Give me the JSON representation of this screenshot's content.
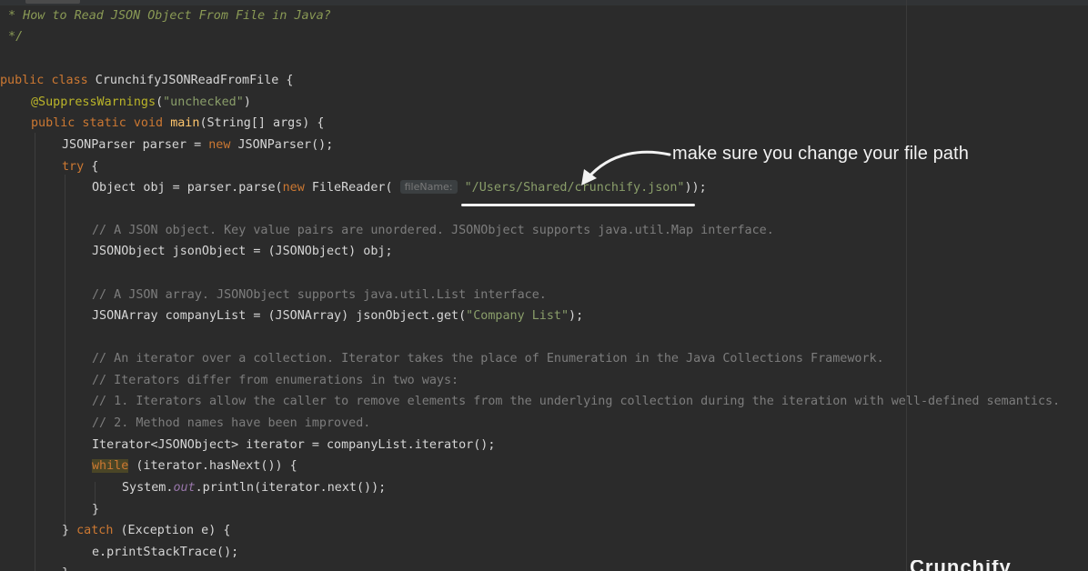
{
  "editor": {
    "language": "java",
    "theme_colors": {
      "background": "#2b2b2b",
      "keyword": "#cc7832",
      "string": "#8a9e6a",
      "comment": "#7d7d7d",
      "doc_comment": "#8a9a55",
      "annotation": "#bbb529",
      "method": "#ffc66d",
      "static_field": "#9876aa"
    },
    "code": {
      "doc_line": " * How to Read JSON Object From File in Java?",
      "doc_close": " */",
      "class_public": "public",
      "class_kw": "class",
      "class_name": " CrunchifyJSONReadFromFile {",
      "annotation": "@SuppressWarnings",
      "annotation_paren_open": "(",
      "annotation_arg": "\"unchecked\"",
      "annotation_paren_close": ")",
      "main_kw": "public static void",
      "main_name": "main",
      "main_rest": "(String[] args) {",
      "parser_decl": "JSONParser parser = ",
      "parser_new": "new",
      "parser_rest": " JSONParser();",
      "try_kw": "try",
      "try_brace": " {",
      "obj_decl": "Object obj = parser.parse(",
      "obj_new": "new",
      "obj_reader": " FileReader( ",
      "param_hint": "fileName:",
      "obj_space": " ",
      "obj_path": "\"/Users/Shared/crunchify.json\"",
      "obj_end": "));",
      "comment_json_object": "// A JSON object. Key value pairs are unordered. JSONObject supports java.util.Map interface.",
      "json_object_line": "JSONObject jsonObject = (JSONObject) obj;",
      "comment_json_array": "// A JSON array. JSONObject supports java.util.List interface.",
      "company_decl": "JSONArray companyList = (JSONArray) jsonObject.get(",
      "company_key": "\"Company List\"",
      "company_end": ");",
      "comment_iter_1": "// An iterator over a collection. Iterator takes the place of Enumeration in the Java Collections Framework.",
      "comment_iter_2": "// Iterators differ from enumerations in two ways:",
      "comment_iter_3": "// 1. Iterators allow the caller to remove elements from the underlying collection during the iteration with well-defined semantics.",
      "comment_iter_4": "// 2. Method names have been improved.",
      "iterator_line": "Iterator<JSONObject> iterator = companyList.iterator();",
      "while_kw": "while",
      "while_rest": " (iterator.hasNext()) {",
      "println_start": "System.",
      "println_field": "out",
      "println_rest": ".println(iterator.next());",
      "close_brace": "}",
      "catch_open": "} ",
      "catch_kw": "catch",
      "catch_rest": " (Exception e) {",
      "stack_trace": "e.printStackTrace();",
      "final_brace": "}"
    }
  },
  "overlay": {
    "annotation_text": "make sure you change your file path",
    "arrow_icon": "curved-arrow-icon",
    "overlay_color": "#f2f2f2"
  },
  "branding": {
    "logo_text": "Crunchify"
  }
}
